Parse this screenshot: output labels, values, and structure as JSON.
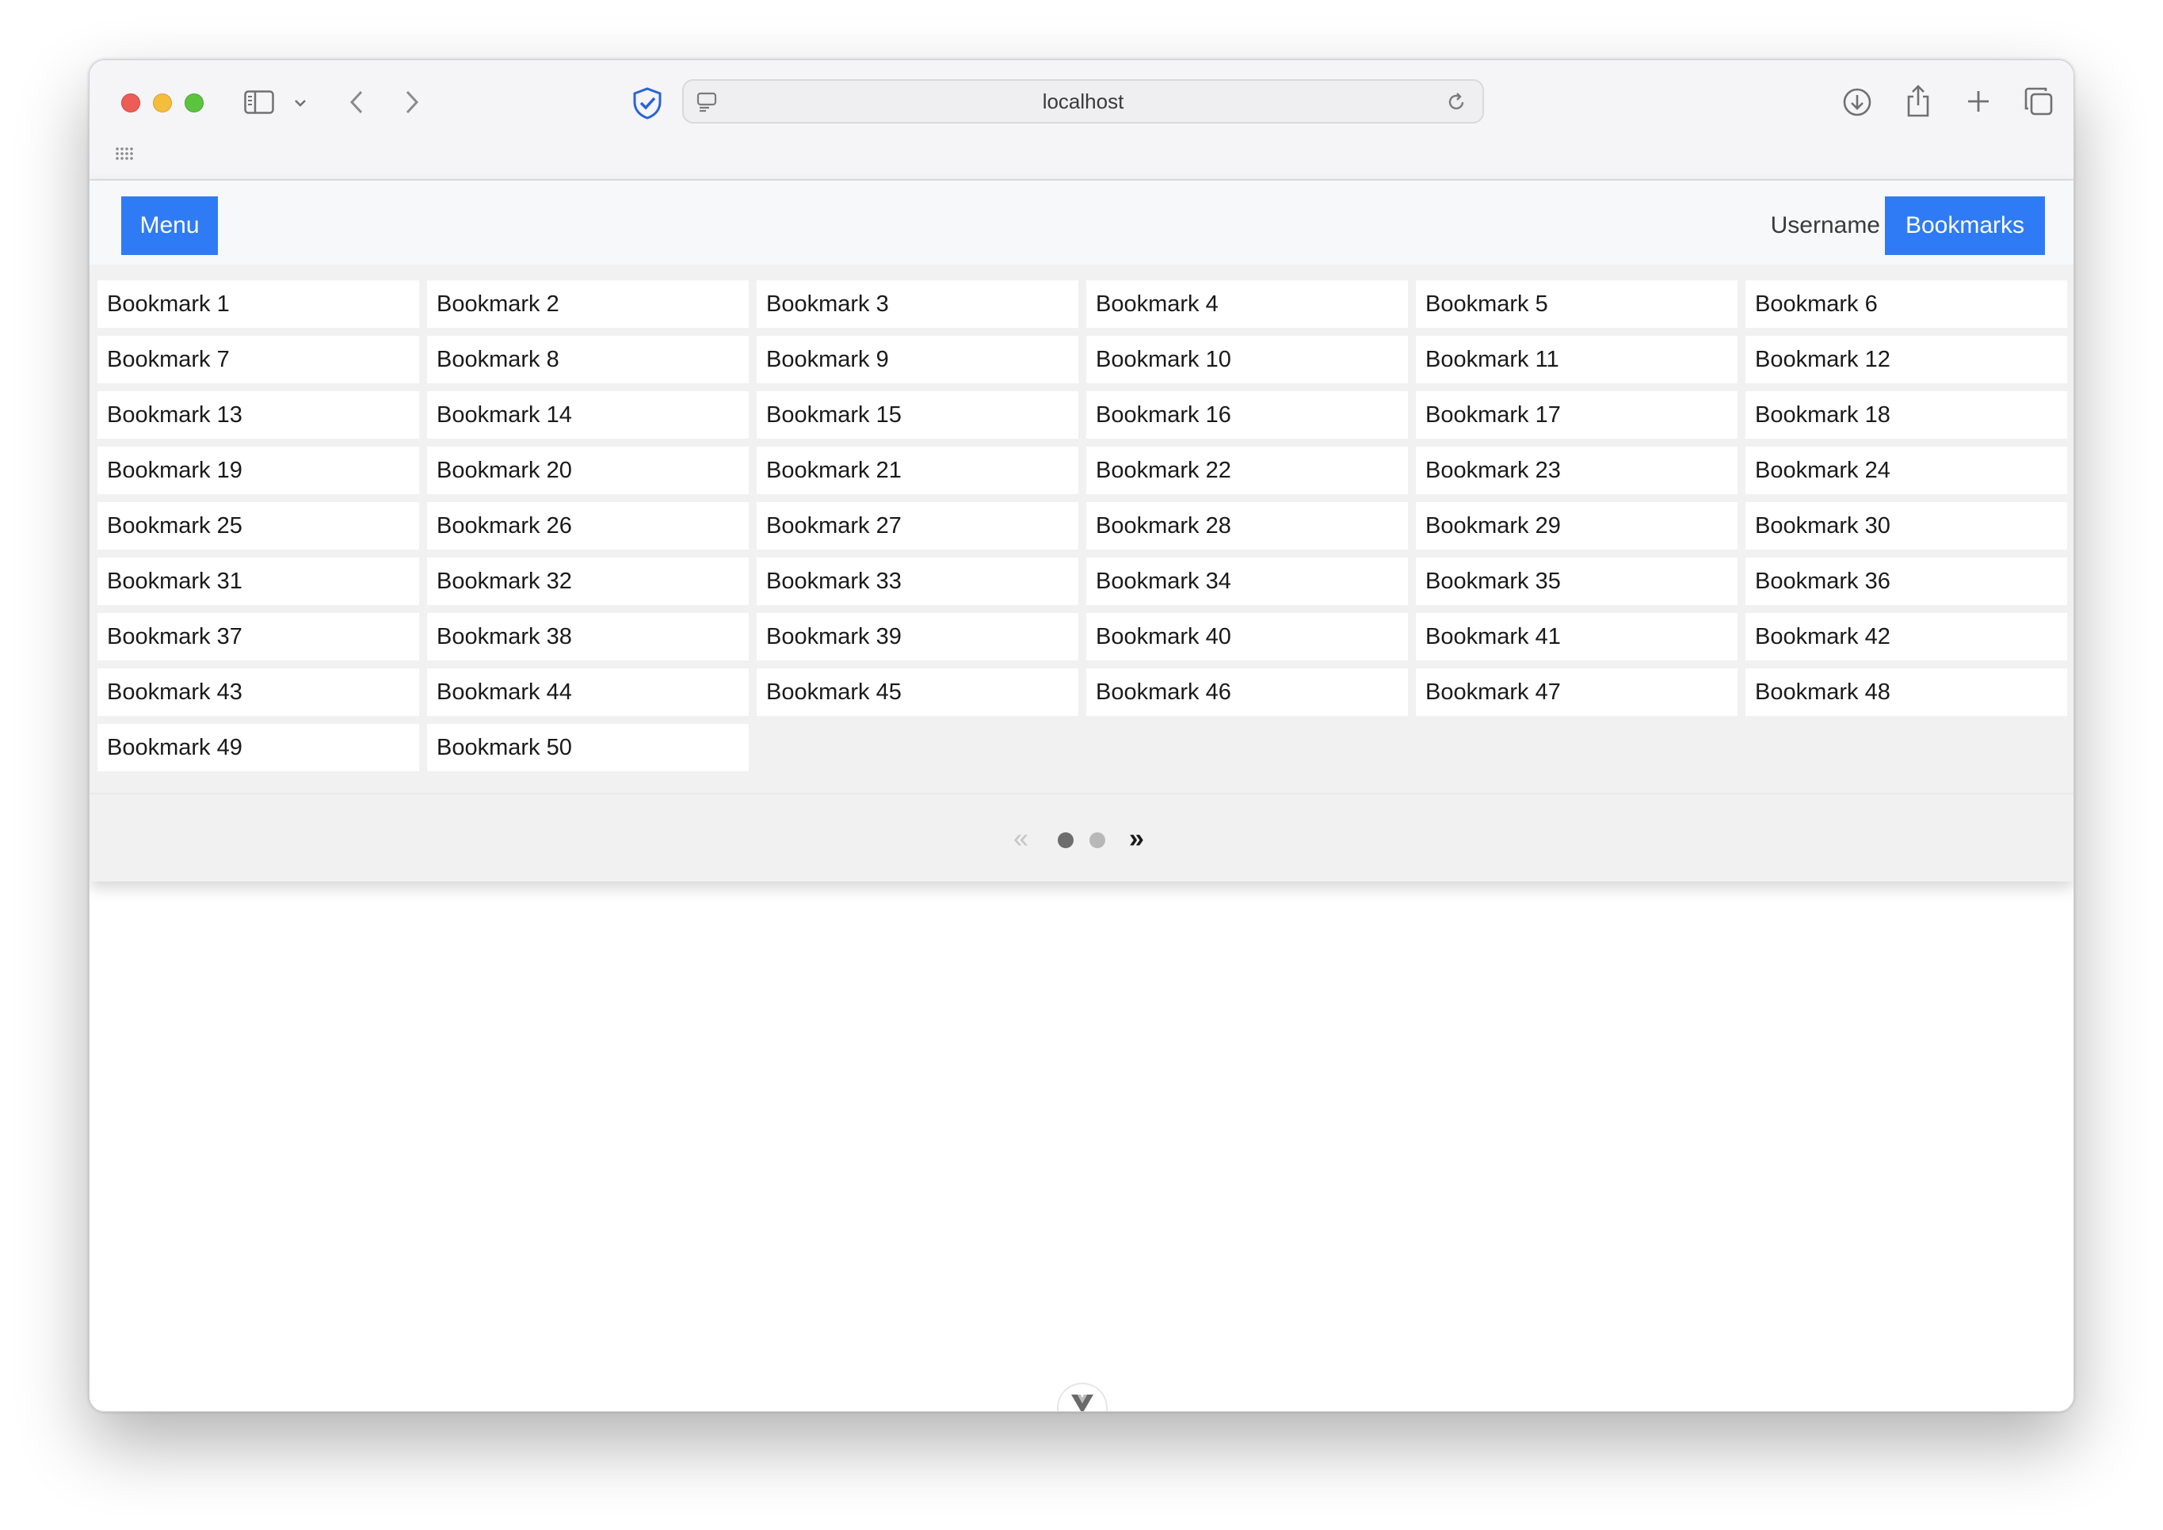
{
  "browser": {
    "address": "localhost"
  },
  "header": {
    "menu_label": "Menu",
    "username": "Username",
    "bookmarks_label": "Bookmarks"
  },
  "bookmarks": [
    "Bookmark 1",
    "Bookmark 2",
    "Bookmark 3",
    "Bookmark 4",
    "Bookmark 5",
    "Bookmark 6",
    "Bookmark 7",
    "Bookmark 8",
    "Bookmark 9",
    "Bookmark 10",
    "Bookmark 11",
    "Bookmark 12",
    "Bookmark 13",
    "Bookmark 14",
    "Bookmark 15",
    "Bookmark 16",
    "Bookmark 17",
    "Bookmark 18",
    "Bookmark 19",
    "Bookmark 20",
    "Bookmark 21",
    "Bookmark 22",
    "Bookmark 23",
    "Bookmark 24",
    "Bookmark 25",
    "Bookmark 26",
    "Bookmark 27",
    "Bookmark 28",
    "Bookmark 29",
    "Bookmark 30",
    "Bookmark 31",
    "Bookmark 32",
    "Bookmark 33",
    "Bookmark 34",
    "Bookmark 35",
    "Bookmark 36",
    "Bookmark 37",
    "Bookmark 38",
    "Bookmark 39",
    "Bookmark 40",
    "Bookmark 41",
    "Bookmark 42",
    "Bookmark 43",
    "Bookmark 44",
    "Bookmark 45",
    "Bookmark 46",
    "Bookmark 47",
    "Bookmark 48",
    "Bookmark 49",
    "Bookmark 50"
  ],
  "pagination": {
    "prev": "«",
    "next": "»",
    "current_page": 1,
    "total_pages": 2
  },
  "colors": {
    "accent": "#2f7bf5",
    "shield": "#2a63d8"
  },
  "icons": {
    "sidebar": "sidebar-icon",
    "chevron_down": "chevron-down-icon",
    "back": "back-arrow-icon",
    "forward": "forward-arrow-icon",
    "shield": "privacy-shield-icon",
    "page_settings": "page-settings-icon",
    "reload": "reload-icon",
    "download": "download-icon",
    "share": "share-icon",
    "new_tab": "new-tab-icon",
    "tab_overview": "tab-overview-icon",
    "grid": "grid-icon",
    "devtools": "vue-devtools-icon"
  }
}
